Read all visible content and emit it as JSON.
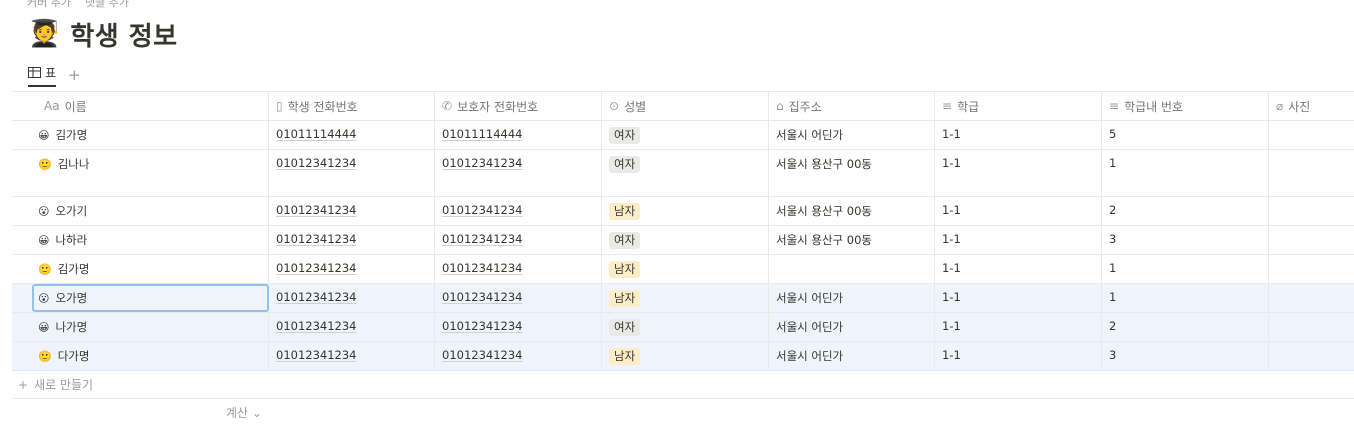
{
  "topbar": {
    "items": [
      "커버 추가",
      "댓글 추가"
    ]
  },
  "page": {
    "emoji": "🧑‍🎓",
    "title": "학생 정보"
  },
  "view": {
    "tab_label": "표",
    "add_symbol": "+"
  },
  "columns": [
    {
      "icon": "Aa",
      "label": "이름"
    },
    {
      "icon": "▯",
      "label": "학생 전화번호"
    },
    {
      "icon": "✆",
      "label": "보호자 전화번호"
    },
    {
      "icon": "⊙",
      "label": "성별"
    },
    {
      "icon": "⌂",
      "label": "집주소"
    },
    {
      "icon": "≡",
      "label": "학급"
    },
    {
      "icon": "≡",
      "label": "학급내 번호"
    },
    {
      "icon": "⌀",
      "label": "사진"
    }
  ],
  "rows": [
    {
      "name": "김가명",
      "student_phone": "01011114444",
      "parent_phone": "01011114444",
      "gender": "여자",
      "address": "서울시 어딘가",
      "class": "1-1",
      "number": "5",
      "photo": ""
    },
    {
      "name": "김나나",
      "student_phone": "01012341234",
      "parent_phone": "01012341234",
      "gender": "여자",
      "address": "서울시 용산구 00동",
      "class": "1-1",
      "number": "1",
      "photo": ""
    },
    {
      "name": "오가기",
      "student_phone": "01012341234",
      "parent_phone": "01012341234",
      "gender": "남자",
      "address": "서울시 용산구 00동",
      "class": "1-1",
      "number": "2",
      "photo": ""
    },
    {
      "name": "나하라",
      "student_phone": "01012341234",
      "parent_phone": "01012341234",
      "gender": "여자",
      "address": "서울시 용산구 00동",
      "class": "1-1",
      "number": "3",
      "photo": ""
    },
    {
      "name": "김가명",
      "student_phone": "01012341234",
      "parent_phone": "01012341234",
      "gender": "남자",
      "address": "",
      "class": "1-1",
      "number": "1",
      "photo": ""
    },
    {
      "name": "오가명",
      "student_phone": "01012341234",
      "parent_phone": "01012341234",
      "gender": "남자",
      "address": "서울시 어딘가",
      "class": "1-1",
      "number": "1",
      "photo": ""
    },
    {
      "name": "나가명",
      "student_phone": "01012341234",
      "parent_phone": "01012341234",
      "gender": "여자",
      "address": "서울시 어딘가",
      "class": "1-1",
      "number": "2",
      "photo": ""
    },
    {
      "name": "다가명",
      "student_phone": "01012341234",
      "parent_phone": "01012341234",
      "gender": "남자",
      "address": "서울시 어딘가",
      "class": "1-1",
      "number": "3",
      "photo": ""
    }
  ],
  "gender_colors": {
    "여자": "#e9e9e7",
    "남자": "#fdecc8"
  },
  "selection_color": "#eef4fb",
  "new_row": {
    "symbol": "+",
    "label": "새로 만들기"
  },
  "footer": {
    "calc_label": "계산",
    "calc_caret": "⌄"
  }
}
